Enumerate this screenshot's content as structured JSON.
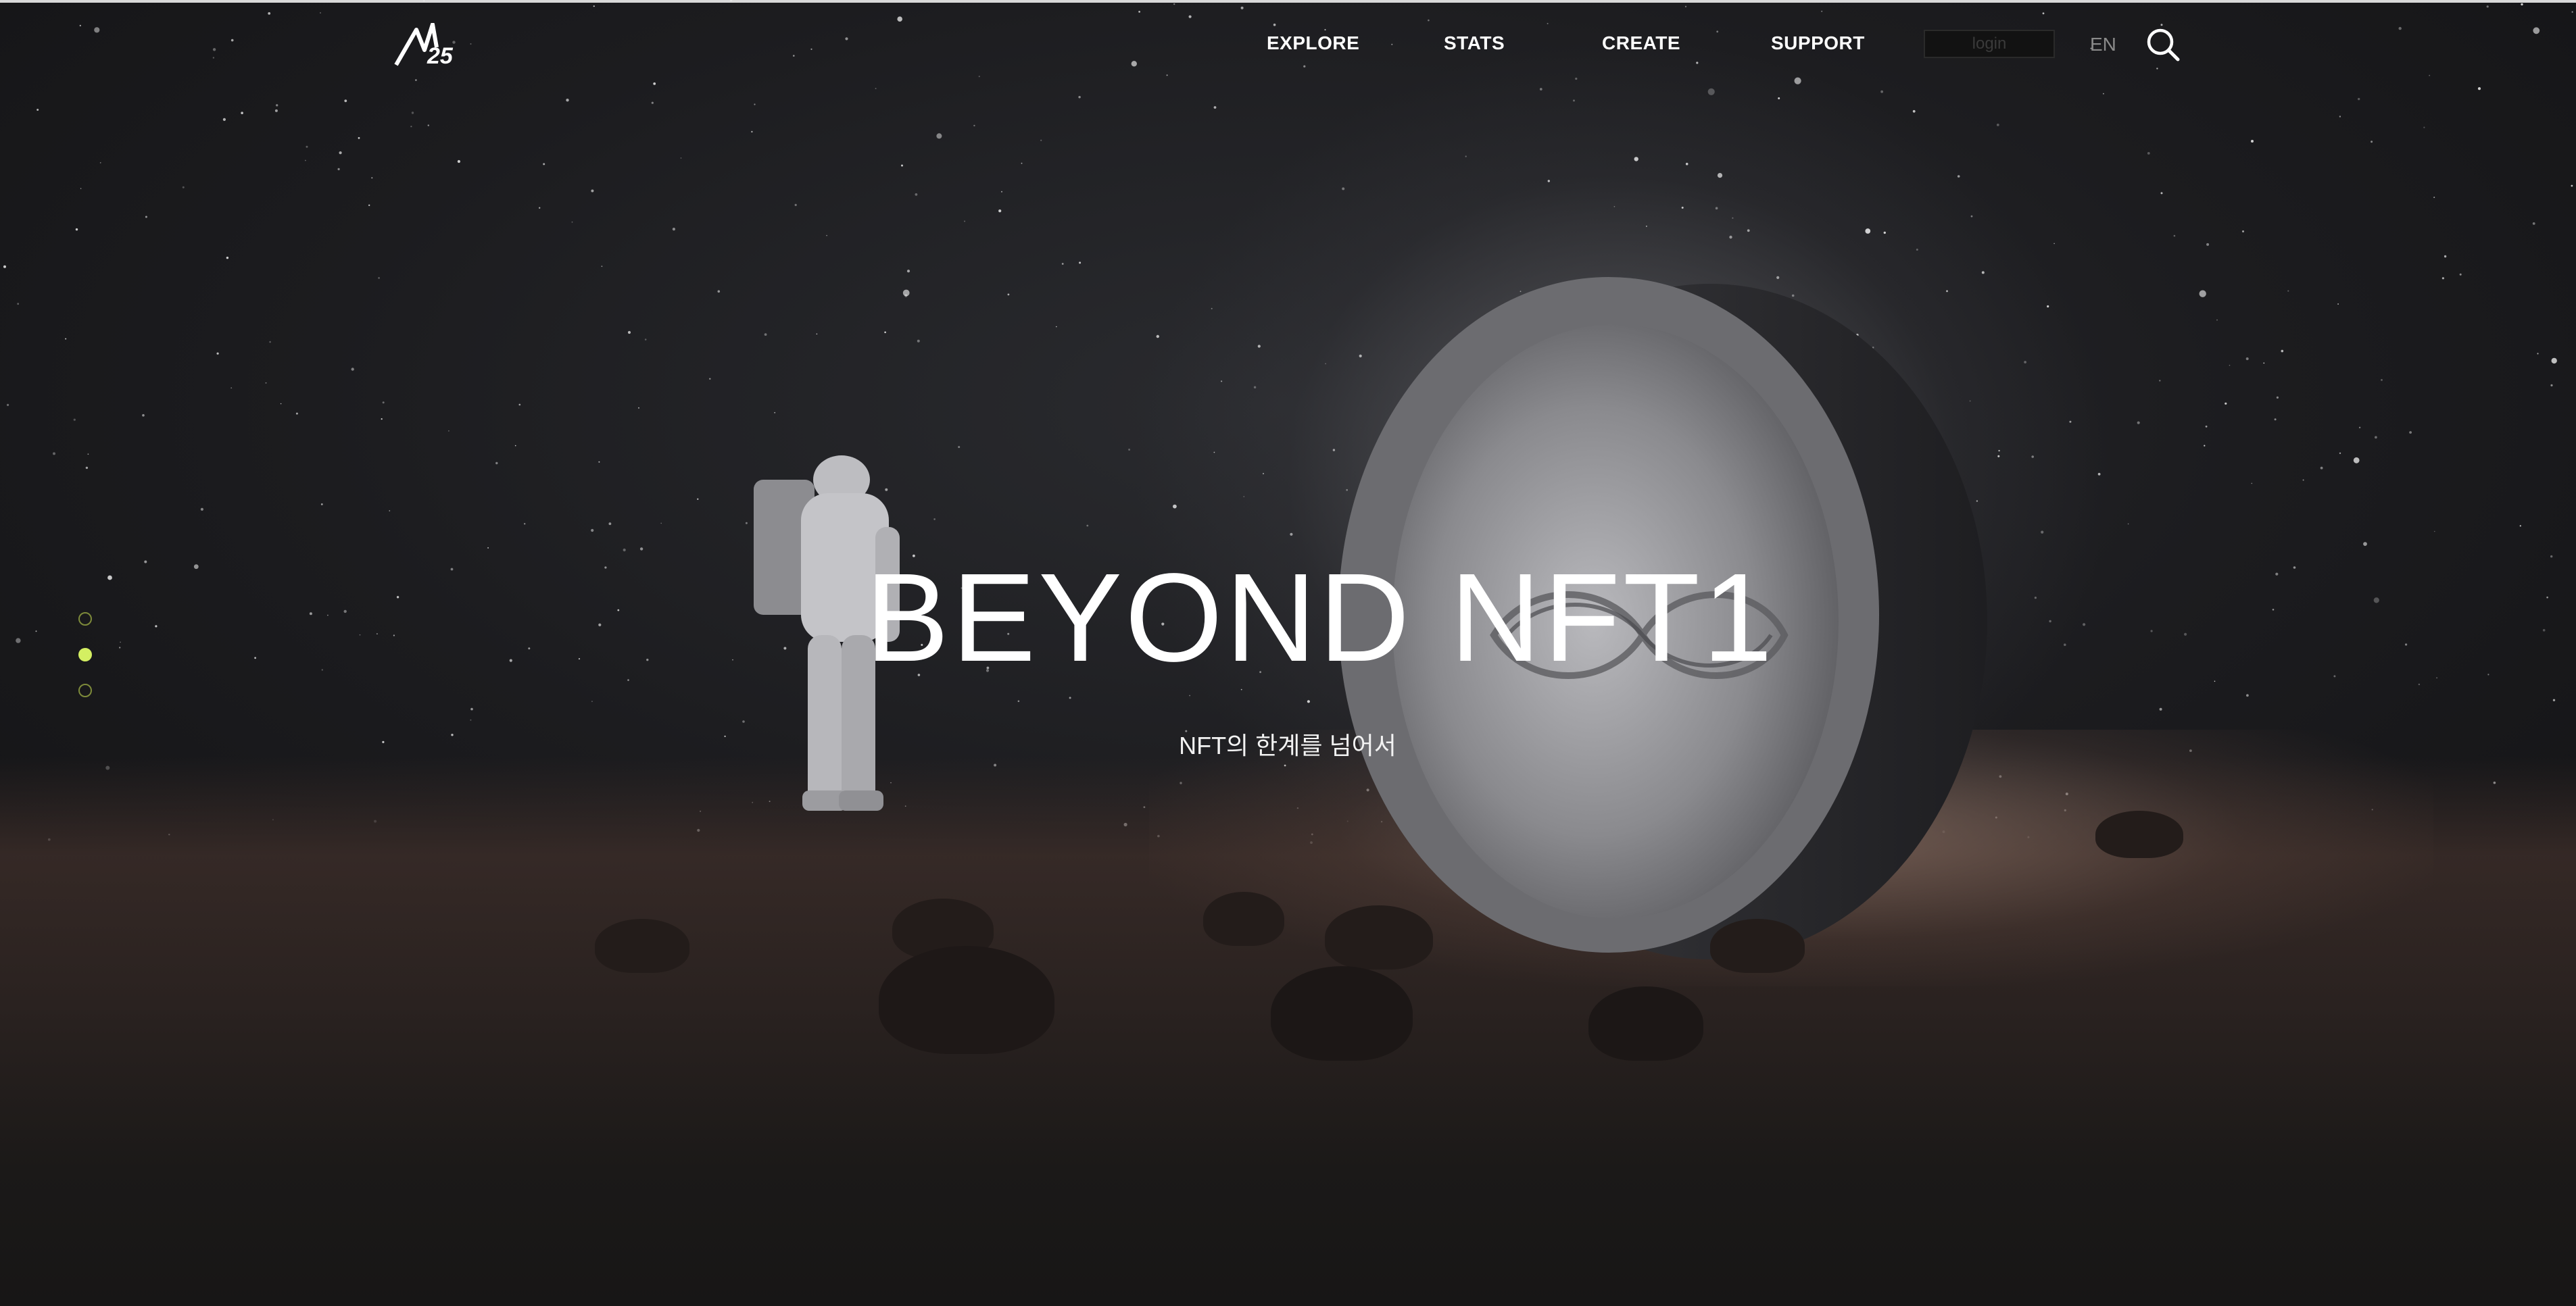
{
  "header": {
    "nav": [
      {
        "label": "EXPLORE"
      },
      {
        "label": "STATS"
      },
      {
        "label": "CREATE"
      },
      {
        "label": "SUPPORT"
      }
    ],
    "login_label": "login",
    "language": "EN"
  },
  "hero": {
    "title": "BEYOND NFT1",
    "subtitle": "NFT의 한계를 넘어서"
  },
  "slider": {
    "count": 3,
    "active_index": 1
  },
  "colors": {
    "accent": "#d4ef62",
    "background": "#1c1c1f",
    "text": "#ffffff"
  },
  "icons": [
    "logo-mark",
    "search-icon"
  ]
}
